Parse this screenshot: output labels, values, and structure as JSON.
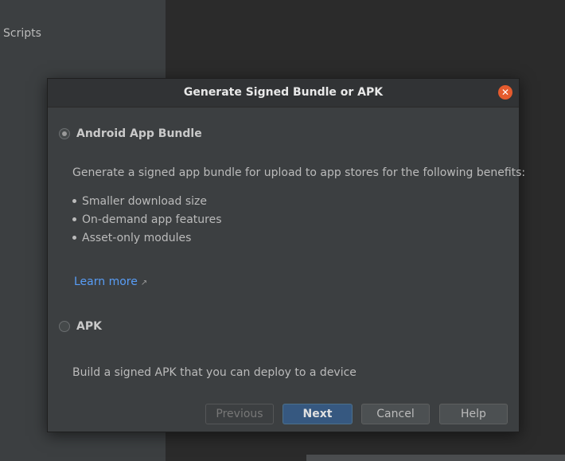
{
  "background": {
    "sidebar_label": "Scripts"
  },
  "dialog": {
    "title": "Generate Signed Bundle or APK",
    "close_icon": "close-icon",
    "options": [
      {
        "label": "Android App Bundle",
        "selected": true,
        "description": "Generate a signed app bundle for upload to app stores for the following benefits:",
        "benefits": [
          "Smaller download size",
          "On-demand app features",
          "Asset-only modules"
        ],
        "link_text": "Learn more",
        "link_icon": "external-link-icon"
      },
      {
        "label": "APK",
        "selected": false,
        "description": "Build a signed APK that you can deploy to a device"
      }
    ],
    "buttons": {
      "previous": "Previous",
      "next": "Next",
      "cancel": "Cancel",
      "help": "Help"
    }
  },
  "colors": {
    "accent": "#365880",
    "link": "#589df6",
    "close": "#e45b2e",
    "dialog_bg": "#3c3f41"
  }
}
